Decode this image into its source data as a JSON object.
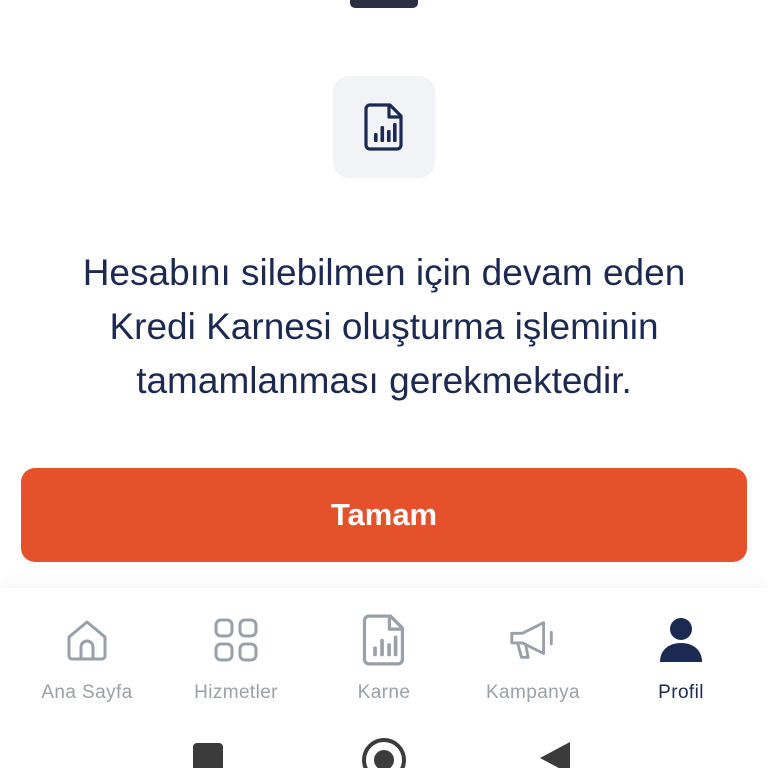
{
  "dialog": {
    "icon": "report-document-icon",
    "message_lines": [
      "Hesabını silebilmen için devam eden",
      "Kredi Karnesi oluşturma işleminin",
      "tamamlanması gerekmektedir."
    ],
    "confirm_label": "Tamam"
  },
  "tabbar": {
    "items": [
      {
        "label": "Ana Sayfa",
        "icon": "home-icon",
        "active": false
      },
      {
        "label": "Hizmetler",
        "icon": "grid-icon",
        "active": false
      },
      {
        "label": "Karne",
        "icon": "report-icon",
        "active": false
      },
      {
        "label": "Kampanya",
        "icon": "megaphone-icon",
        "active": false
      },
      {
        "label": "Profil",
        "icon": "profile-icon",
        "active": true
      }
    ]
  },
  "colors": {
    "primary_text": "#1c2a52",
    "accent": "#e4512b",
    "inactive": "#9aa0a8",
    "tile_bg": "#f1f3f6"
  }
}
